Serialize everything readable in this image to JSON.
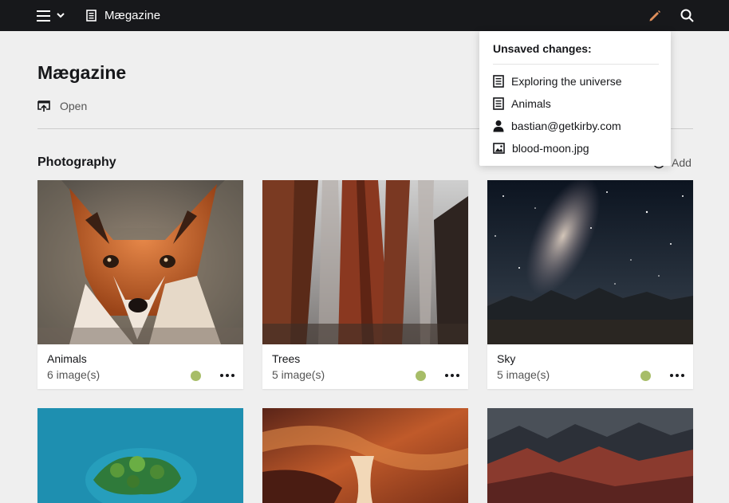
{
  "topbar": {
    "site_title": "Mægazine",
    "menu_icon": "hamburger-menu-icon",
    "edit_icon": "pencil-icon",
    "search_icon": "search-icon",
    "colors": {
      "background": "#17181b",
      "edit_accent": "#e08e5a"
    }
  },
  "page": {
    "title": "Mægazine",
    "open_label": "Open"
  },
  "section": {
    "title": "Photography",
    "add_label": "Add"
  },
  "cards": [
    {
      "title": "Animals",
      "count": "6 image(s)",
      "image": "fox-photo"
    },
    {
      "title": "Trees",
      "count": "5 image(s)",
      "image": "redwood-trees-photo"
    },
    {
      "title": "Sky",
      "count": "5 image(s)",
      "image": "milky-way-photo"
    },
    {
      "title": "",
      "count": "",
      "image": "island-aerial-photo"
    },
    {
      "title": "",
      "count": "",
      "image": "canyon-photo"
    },
    {
      "title": "",
      "count": "",
      "image": "mountains-photo"
    }
  ],
  "status_color": "#a7bd68",
  "unsaved_dropdown": {
    "title": "Unsaved changes:",
    "items": [
      {
        "label": "Exploring the universe",
        "icon": "page-icon"
      },
      {
        "label": "Animals",
        "icon": "page-icon"
      },
      {
        "label": "bastian@getkirby.com",
        "icon": "user-icon"
      },
      {
        "label": "blood-moon.jpg",
        "icon": "image-icon"
      }
    ]
  }
}
